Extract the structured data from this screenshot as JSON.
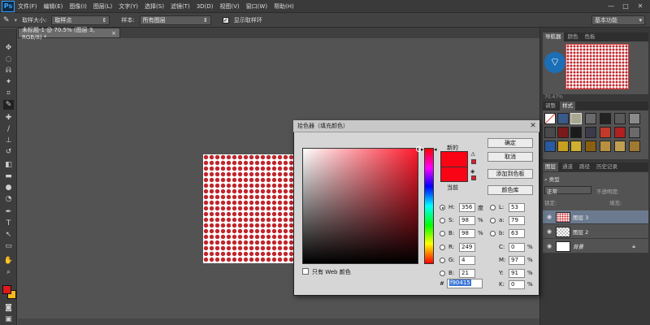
{
  "app": {
    "logo": "Ps"
  },
  "menu": [
    "文件(F)",
    "编辑(E)",
    "图像(I)",
    "图层(L)",
    "文字(Y)",
    "选择(S)",
    "滤镜(T)",
    "3D(D)",
    "视图(V)",
    "窗口(W)",
    "帮助(H)"
  ],
  "window_controls": [
    "—",
    "□",
    "✕"
  ],
  "options": {
    "sample_size_label": "取样大小:",
    "sample_size_value": "取样点",
    "sample_label": "样本:",
    "sample_value": "所有图层",
    "show_ring_label": "显示取样环",
    "workspace": "基本功能"
  },
  "document": {
    "tab_title": "未标题-1 @ 70.5% (图层 3, RGB/8) *",
    "close": "×"
  },
  "panels": {
    "navigator_tabs": [
      "导航器",
      "颜色",
      "色板"
    ],
    "zoom": "70.47%",
    "style_tabs": [
      "调整",
      "样式"
    ],
    "layer_tabs": [
      "图层",
      "通道",
      "路径",
      "历史记录"
    ],
    "kind_label": "类型",
    "blend_mode": "正常",
    "opacity_label": "不透明度:",
    "lock_label": "锁定:",
    "fill_label": "填充:",
    "layers": [
      {
        "name": "图层 3",
        "selected": true
      },
      {
        "name": "图层 2",
        "selected": false
      },
      {
        "name": "背景",
        "selected": false
      }
    ]
  },
  "color_picker": {
    "title": "拾色器（填充颜色）",
    "new_label": "新的",
    "current_label": "当前",
    "ok": "确定",
    "cancel": "取消",
    "add_to_swatches": "添加到色板",
    "color_libraries": "颜色库",
    "web_only": "只有 Web 颜色",
    "selected_color": "#f90415",
    "fields": {
      "H": {
        "label": "H:",
        "value": "356",
        "unit": "度"
      },
      "S": {
        "label": "S:",
        "value": "98",
        "unit": "%"
      },
      "Bv": {
        "label": "B:",
        "value": "98",
        "unit": "%"
      },
      "R": {
        "label": "R:",
        "value": "249"
      },
      "G": {
        "label": "G:",
        "value": "4"
      },
      "Bb": {
        "label": "B:",
        "value": "21"
      },
      "L": {
        "label": "L:",
        "value": "53"
      },
      "a": {
        "label": "a:",
        "value": "79"
      },
      "b": {
        "label": "b:",
        "value": "63"
      },
      "C": {
        "label": "C:",
        "value": "0",
        "unit": "%"
      },
      "M": {
        "label": "M:",
        "value": "97",
        "unit": "%"
      },
      "Y": {
        "label": "Y:",
        "value": "91",
        "unit": "%"
      },
      "K": {
        "label": "K:",
        "value": "0",
        "unit": "%"
      }
    },
    "hex_label": "#",
    "hex": "f90415"
  },
  "colors": {
    "foreground": "#e01a1a",
    "background": "#f5b91e",
    "accent": "#f90415"
  }
}
